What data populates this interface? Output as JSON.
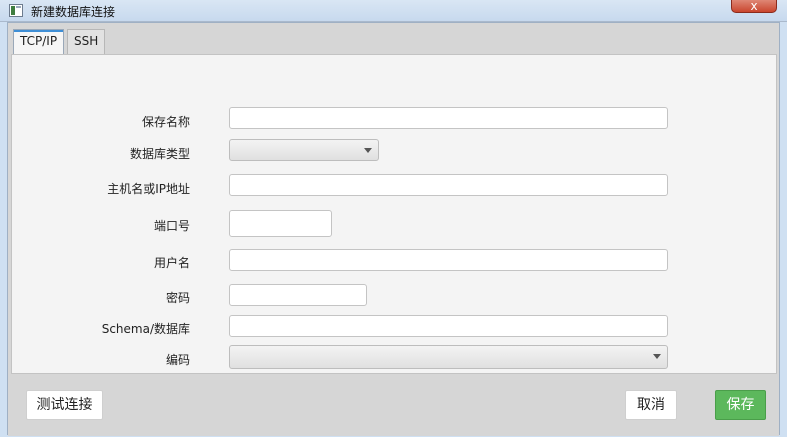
{
  "window": {
    "title": "新建数据库连接",
    "close_glyph": "x",
    "app_icon": "app-window-icon"
  },
  "tabs": [
    {
      "label": "TCP/IP",
      "active": true
    },
    {
      "label": "SSH",
      "active": false
    }
  ],
  "form": {
    "save_name": {
      "label": "保存名称",
      "value": ""
    },
    "db_type": {
      "label": "数据库类型",
      "value": ""
    },
    "host": {
      "label": "主机名或IP地址",
      "value": ""
    },
    "port": {
      "label": "端口号",
      "value": ""
    },
    "username": {
      "label": "用户名",
      "value": ""
    },
    "password": {
      "label": "密码",
      "value": ""
    },
    "schema": {
      "label": "Schema/数据库",
      "value": ""
    },
    "encoding": {
      "label": "编码",
      "value": ""
    }
  },
  "footer": {
    "test_label": "测试连接",
    "cancel_label": "取消",
    "save_label": "保存"
  },
  "colors": {
    "save_button": "#5cb85c",
    "active_tab_accent": "#3f8fd6"
  }
}
